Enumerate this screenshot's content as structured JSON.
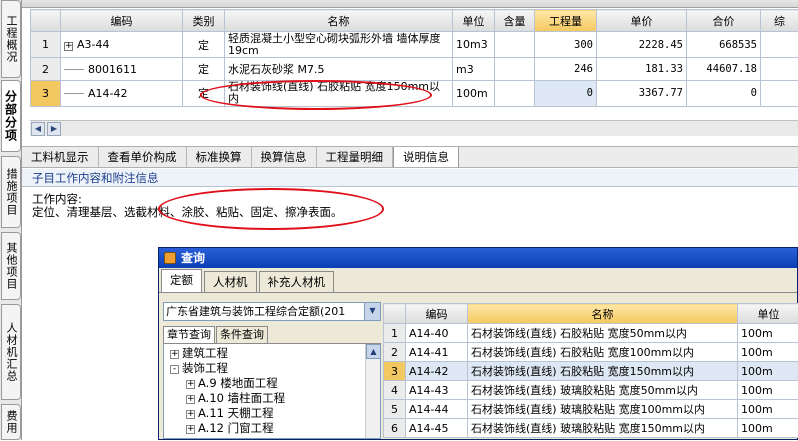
{
  "side_tabs": [
    "工程概况",
    "分部分项",
    "措施项目",
    "其他项目",
    "人材机汇总",
    "费用"
  ],
  "active_side_tab": "分部分项",
  "grid": {
    "headers": [
      "编码",
      "类别",
      "名称",
      "单位",
      "含量",
      "工程量",
      "单价",
      "合价",
      "综"
    ],
    "rows": [
      {
        "no": "1",
        "code": "A3-44",
        "type": "定",
        "name": "轻质混凝土小型空心砌块弧形外墙 墙体厚度 19cm",
        "unit": "10m3",
        "content": "",
        "qty": "300",
        "price": "2228.45",
        "total": "668535"
      },
      {
        "no": "2",
        "code": "8001611",
        "type": "定",
        "name": "水泥石灰砂浆 M7.5",
        "unit": "m3",
        "content": "",
        "qty": "246",
        "price": "181.33",
        "total": "44607.18"
      },
      {
        "no": "3",
        "code": "A14-42",
        "type": "定",
        "name": "石材装饰线(直线) 石胶粘贴 宽度150mm以内",
        "unit": "100m",
        "content": "",
        "qty": "0",
        "price": "3367.77",
        "total": "0"
      }
    ]
  },
  "sub_tabs": [
    "工料机显示",
    "查看单价构成",
    "标准换算",
    "换算信息",
    "工程量明细",
    "说明信息"
  ],
  "active_sub_tab": "说明信息",
  "section_title": "子目工作内容和附注信息",
  "work_content_label": "工作内容:",
  "work_content_text": "定位、清理基层、选截材料、涂胶、粘贴、固定、擦净表面。",
  "dialog": {
    "title": "查询",
    "tabs": [
      "定额",
      "人材机",
      "补充人材机"
    ],
    "active_tab": "定额",
    "quota_library": "广东省建筑与装饰工程综合定额(201",
    "left_tabs": [
      "章节查询",
      "条件查询"
    ],
    "tree": [
      {
        "level": 0,
        "box": "+",
        "label": "建筑工程"
      },
      {
        "level": 0,
        "box": "-",
        "label": "装饰工程"
      },
      {
        "level": 1,
        "box": "+",
        "label": "A.9 楼地面工程"
      },
      {
        "level": 1,
        "box": "+",
        "label": "A.10 墙柱面工程"
      },
      {
        "level": 1,
        "box": "+",
        "label": "A.11 天棚工程"
      },
      {
        "level": 1,
        "box": "+",
        "label": "A.12 门窗工程"
      }
    ],
    "list_headers": [
      "编码",
      "名称",
      "单位"
    ],
    "list": [
      {
        "no": "1",
        "code": "A14-40",
        "name": "石材装饰线(直线) 石胶粘贴 宽度50mm以内",
        "unit": "100m"
      },
      {
        "no": "2",
        "code": "A14-41",
        "name": "石材装饰线(直线) 石胶粘贴 宽度100mm以内",
        "unit": "100m"
      },
      {
        "no": "3",
        "code": "A14-42",
        "name": "石材装饰线(直线) 石胶粘贴 宽度150mm以内",
        "unit": "100m"
      },
      {
        "no": "4",
        "code": "A14-43",
        "name": "石材装饰线(直线) 玻璃胶粘贴 宽度50mm以内",
        "unit": "100m"
      },
      {
        "no": "5",
        "code": "A14-44",
        "name": "石材装饰线(直线) 玻璃胶粘贴 宽度100mm以内",
        "unit": "100m"
      },
      {
        "no": "6",
        "code": "A14-45",
        "name": "石材装饰线(直线) 玻璃胶粘贴 宽度150mm以内",
        "unit": "100m"
      }
    ]
  },
  "colors": {
    "annotation": "#e0101a",
    "highlight_header": "#f4c860",
    "selected_cell": "#dde8f4",
    "dialog_title": "#0a3fb4"
  }
}
